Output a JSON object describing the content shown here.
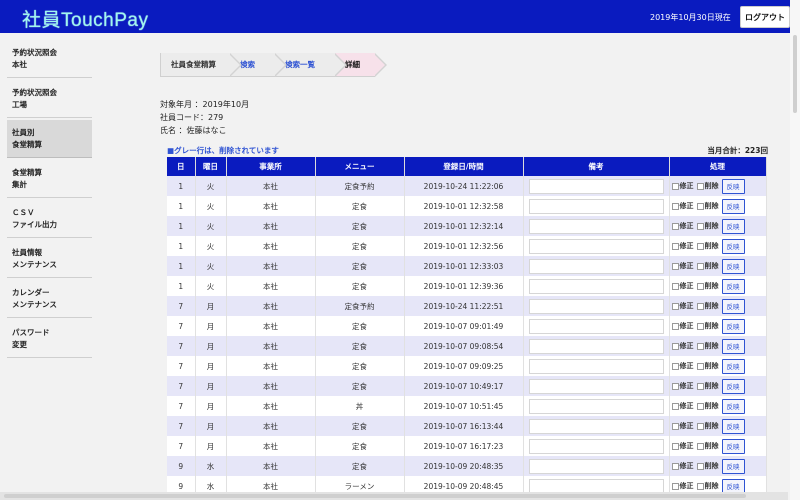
{
  "app": {
    "logo": "社員TouchPay"
  },
  "header": {
    "date_label": "2019年10月30日現在",
    "logout": "ログアウト"
  },
  "sidebar": [
    {
      "line1": "予約状況照会",
      "line2": "本社"
    },
    {
      "line1": "予約状況照会",
      "line2": "工場"
    },
    {
      "line1": "社員別",
      "line2": "食堂精算"
    },
    {
      "line1": "食堂精算",
      "line2": "集計"
    },
    {
      "line1": "ＣＳＶ",
      "line2": "ファイル出力"
    },
    {
      "line1": "社員情報",
      "line2": "メンテナンス"
    },
    {
      "line1": "カレンダー",
      "line2": "メンテナンス"
    },
    {
      "line1": "パスワード",
      "line2": "変更"
    }
  ],
  "breadcrumb": [
    "社員食堂精算",
    "検索",
    "検索一覧",
    "詳細"
  ],
  "info": {
    "month": "対象年月 ：2019年10月",
    "code": "社員コード：279",
    "name": "氏名 ：佐藤はなこ"
  },
  "notice": "■グレー行は、削除されています",
  "total": "当月合計：223回",
  "table": {
    "headers": [
      "日",
      "曜日",
      "事業所",
      "メニュー",
      "登録日/時間",
      "備考",
      "処理"
    ],
    "labels": {
      "fix": "修正",
      "delete": "削除",
      "reflect": "反映"
    },
    "rows": [
      [
        "1",
        "火",
        "本社",
        "定食予約",
        "2019-10-24 11:22:06"
      ],
      [
        "1",
        "火",
        "本社",
        "定食",
        "2019-10-01 12:32:58"
      ],
      [
        "1",
        "火",
        "本社",
        "定食",
        "2019-10-01 12:32:14"
      ],
      [
        "1",
        "火",
        "本社",
        "定食",
        "2019-10-01 12:32:56"
      ],
      [
        "1",
        "火",
        "本社",
        "定食",
        "2019-10-01 12:33:03"
      ],
      [
        "1",
        "火",
        "本社",
        "定食",
        "2019-10-01 12:39:36"
      ],
      [
        "7",
        "月",
        "本社",
        "定食予約",
        "2019-10-24 11:22:51"
      ],
      [
        "7",
        "月",
        "本社",
        "定食",
        "2019-10-07 09:01:49"
      ],
      [
        "7",
        "月",
        "本社",
        "定食",
        "2019-10-07 09:08:54"
      ],
      [
        "7",
        "月",
        "本社",
        "定食",
        "2019-10-07 09:09:25"
      ],
      [
        "7",
        "月",
        "本社",
        "定食",
        "2019-10-07 10:49:17"
      ],
      [
        "7",
        "月",
        "本社",
        "丼",
        "2019-10-07 10:51:45"
      ],
      [
        "7",
        "月",
        "本社",
        "定食",
        "2019-10-07 16:13:44"
      ],
      [
        "7",
        "月",
        "本社",
        "定食",
        "2019-10-07 16:17:23"
      ],
      [
        "9",
        "水",
        "本社",
        "定食",
        "2019-10-09 20:48:35"
      ],
      [
        "9",
        "水",
        "本社",
        "ラーメン",
        "2019-10-09 20:48:45"
      ]
    ]
  }
}
